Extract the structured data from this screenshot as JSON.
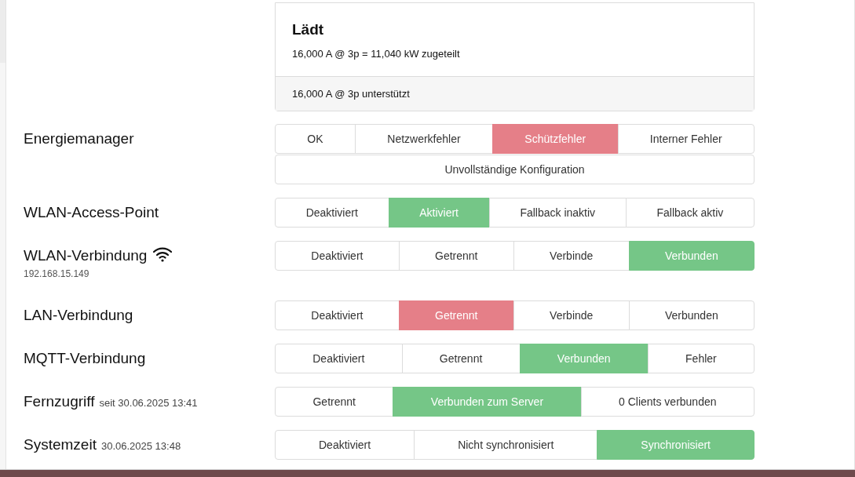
{
  "charger_card": {
    "title": "Lädt",
    "detail": "16,000 A @ 3p = 11,040 kW zugeteilt",
    "footer": "16,000 A @ 3p unterstützt"
  },
  "status_rows": [
    {
      "label": "Energiemanager",
      "button_rows": [
        [
          {
            "label": "OK",
            "selected": false
          },
          {
            "label": "Netzwerkfehler",
            "selected": false
          },
          {
            "label": "Schützfehler",
            "selected": true,
            "color": "#e57f88"
          },
          {
            "label": "Interner Fehler",
            "selected": false
          }
        ],
        [
          {
            "label": "Unvollständige Konfiguration",
            "selected": false
          }
        ]
      ]
    },
    {
      "label": "WLAN-Access-Point",
      "button_rows": [
        [
          {
            "label": "Deaktiviert",
            "selected": false
          },
          {
            "label": "Aktiviert",
            "selected": true,
            "color": "#75c687"
          },
          {
            "label": "Fallback inaktiv",
            "selected": false
          },
          {
            "label": "Fallback aktiv",
            "selected": false
          }
        ]
      ]
    },
    {
      "label": "WLAN-Verbindung",
      "wifi_icon": true,
      "subtext": "192.168.15.149",
      "button_rows": [
        [
          {
            "label": "Deaktiviert",
            "selected": false
          },
          {
            "label": "Getrennt",
            "selected": false
          },
          {
            "label": "Verbinde",
            "selected": false
          },
          {
            "label": "Verbunden",
            "selected": true,
            "color": "#75c687"
          }
        ]
      ]
    },
    {
      "label": "LAN-Verbindung",
      "button_rows": [
        [
          {
            "label": "Deaktiviert",
            "selected": false
          },
          {
            "label": "Getrennt",
            "selected": true,
            "color": "#e57f88"
          },
          {
            "label": "Verbinde",
            "selected": false
          },
          {
            "label": "Verbunden",
            "selected": false
          }
        ]
      ]
    },
    {
      "label": "MQTT-Verbindung",
      "button_rows": [
        [
          {
            "label": "Deaktiviert",
            "selected": false
          },
          {
            "label": "Getrennt",
            "selected": false
          },
          {
            "label": "Verbunden",
            "selected": true,
            "color": "#75c687"
          },
          {
            "label": "Fehler",
            "selected": false
          }
        ]
      ]
    },
    {
      "label": "Fernzugriff",
      "inline_note": "seit 30.06.2025 13:41",
      "button_rows": [
        [
          {
            "label": "Getrennt",
            "selected": false
          },
          {
            "label": "Verbunden zum Server",
            "selected": true,
            "color": "#75c687"
          },
          {
            "label": "0 Clients verbunden",
            "selected": false
          }
        ]
      ]
    },
    {
      "label": "Systemzeit",
      "inline_note": "30.06.2025 13:48",
      "button_rows": [
        [
          {
            "label": "Deaktiviert",
            "selected": false
          },
          {
            "label": "Nicht synchronisiert",
            "selected": false
          },
          {
            "label": "Synchronisiert",
            "selected": true,
            "color": "#75c687"
          }
        ]
      ]
    }
  ]
}
